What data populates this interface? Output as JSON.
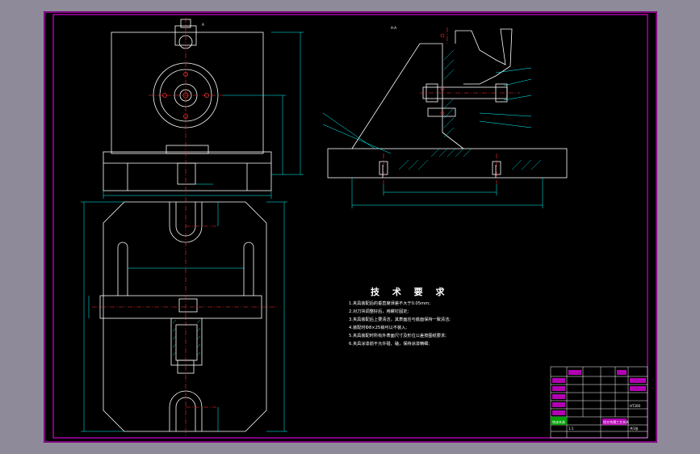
{
  "section_label": "A-A",
  "view_marker": "A",
  "tech_requirements": {
    "title": "技 术 要 求",
    "items": [
      "1.夹具装配后的垂直度误差不大于0.05mm;",
      "2.对刀块调整好后，用螺钉固定;",
      "3.夹具装配后上要清洁，其表面应与底面保持一致清洁;",
      "4.装配时Ф8×25销可以不装入;",
      "5.夹具装配时所有外表面尺寸及形位公差按图纸要求;",
      "6.夹具涂漆前不允许碰、磕，保持涂漆精细;"
    ]
  },
  "title_block": {
    "drawing_name": "拨叉铣槽工艺夹具",
    "stamp": "铣床夹具",
    "material": "HT200",
    "scale": "1:1",
    "sheet": "共1张"
  },
  "colors": {
    "background": "#000000",
    "frame": "#ff00ff",
    "part_outline": "#ffffff",
    "dimension": "#00ffff",
    "centerline": "#ff3030",
    "hatch": "#00ffff",
    "title_fill": "#00a000"
  }
}
